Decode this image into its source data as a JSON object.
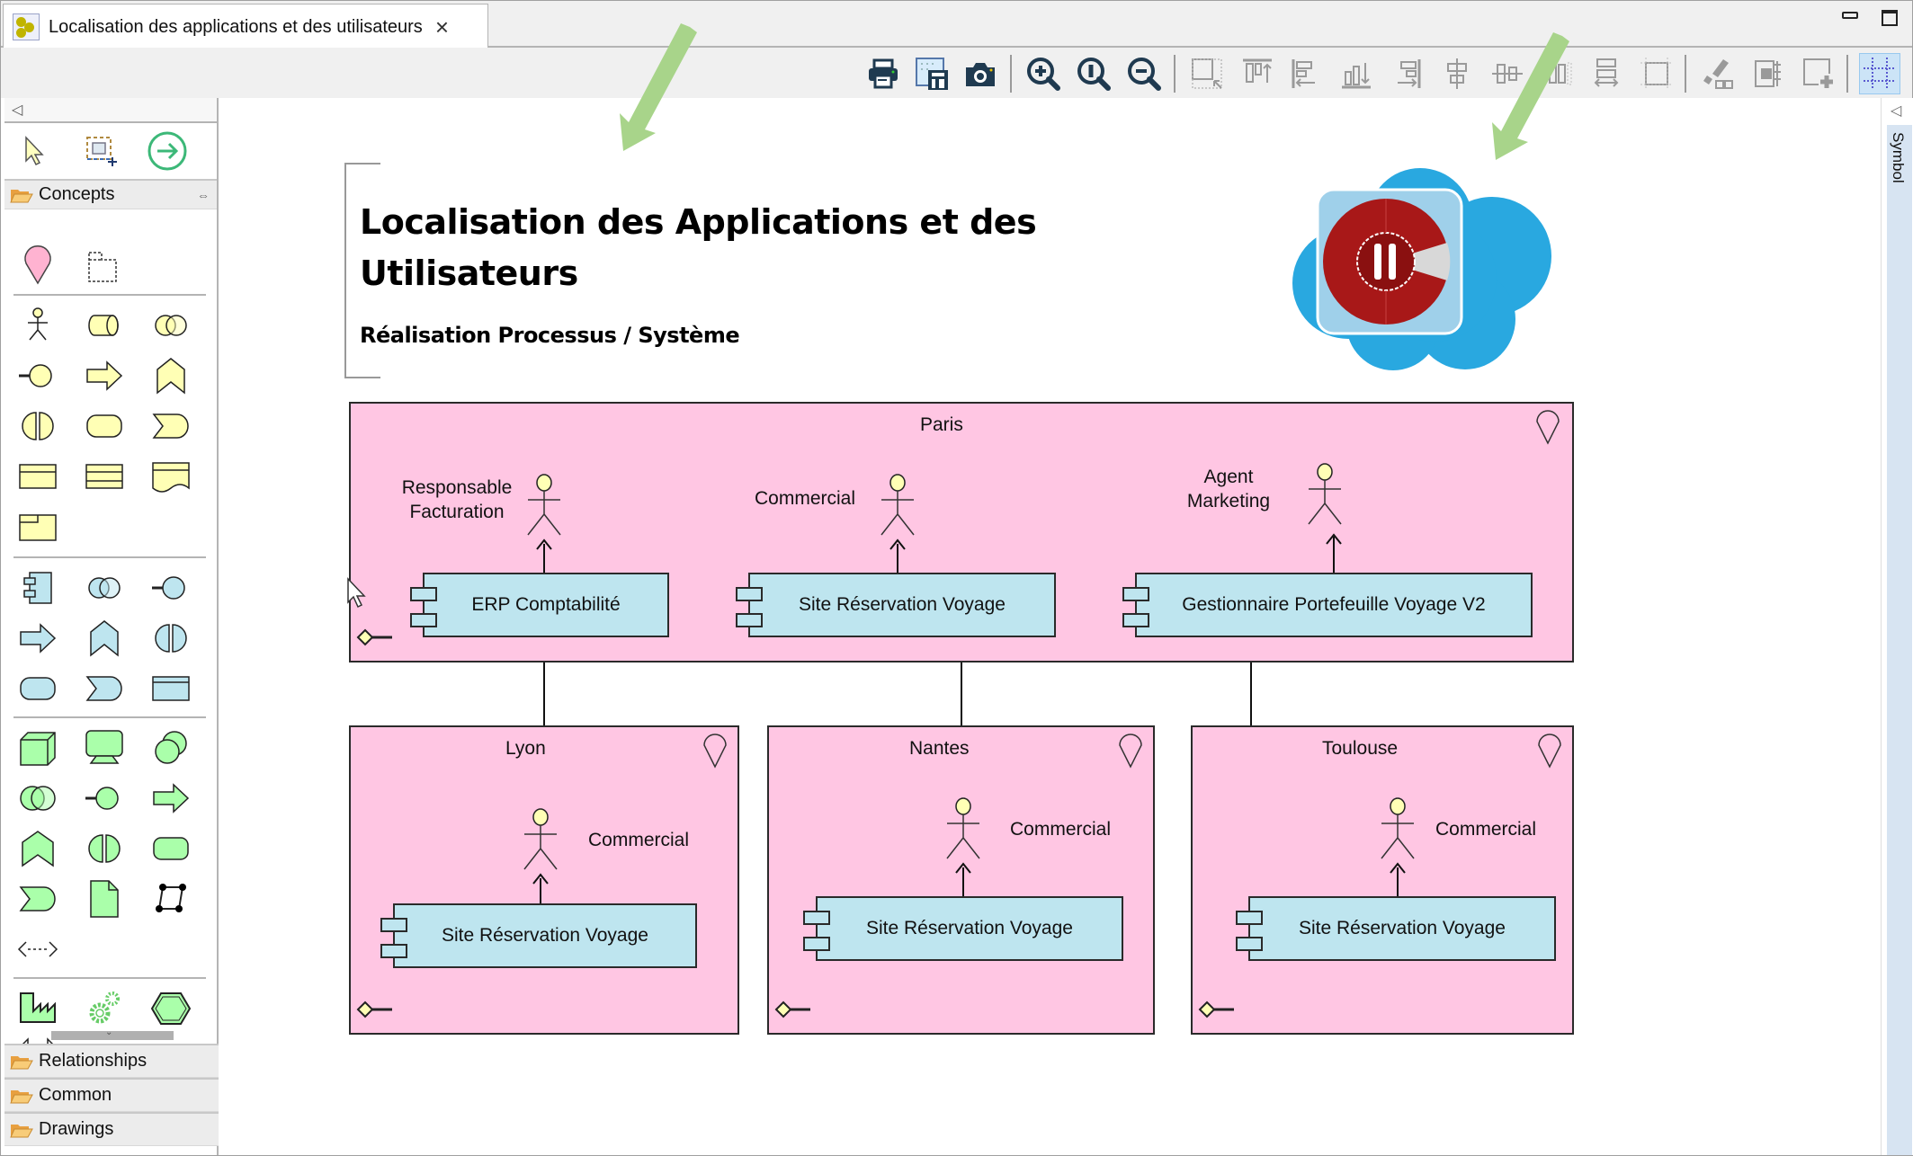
{
  "tab": {
    "title": "Localisation des applications et des utilisateurs",
    "close_label": "×"
  },
  "toolbar": {
    "buttons": [
      {
        "name": "print",
        "icon": "printer-icon"
      },
      {
        "name": "save-as-image",
        "icon": "save-image-icon"
      },
      {
        "name": "snapshot",
        "icon": "camera-icon"
      },
      {
        "name": "zoom-in",
        "icon": "zoom-in-icon"
      },
      {
        "name": "zoom-normal",
        "icon": "zoom-reset-icon"
      },
      {
        "name": "zoom-out",
        "icon": "zoom-out-icon"
      },
      {
        "name": "match-size",
        "icon": "match-size-icon"
      },
      {
        "name": "align-top",
        "icon": "align-top-icon"
      },
      {
        "name": "align-left",
        "icon": "align-left-icon"
      },
      {
        "name": "align-bottom",
        "icon": "align-bottom-icon"
      },
      {
        "name": "align-right",
        "icon": "align-right-icon"
      },
      {
        "name": "align-center",
        "icon": "align-center-icon"
      },
      {
        "name": "align-middle",
        "icon": "align-middle-icon"
      },
      {
        "name": "match-width",
        "icon": "match-width-icon"
      },
      {
        "name": "match-height",
        "icon": "match-height-icon"
      },
      {
        "name": "default-size",
        "icon": "default-size-icon"
      },
      {
        "name": "format-painter",
        "icon": "format-painter-icon"
      },
      {
        "name": "reset-size",
        "icon": "reset-size-icon"
      },
      {
        "name": "new-element",
        "icon": "add-element-icon"
      },
      {
        "name": "grid",
        "icon": "grid-icon"
      }
    ]
  },
  "palette": {
    "drawers": {
      "concepts": "Concepts",
      "relationships": "Relationships",
      "common": "Common",
      "drawings": "Drawings"
    },
    "tools": [
      "select-tool",
      "marquee-tool",
      "magic-connector"
    ]
  },
  "symbol_panel": {
    "label": "Symbol"
  },
  "diagram": {
    "title": "Localisation des Applications et des Utilisateurs",
    "subtitle": "Réalisation Processus / Système",
    "locations": [
      {
        "name": "Paris",
        "actors": [
          {
            "label": "Responsable Facturation",
            "application": "ERP Comptabilité"
          },
          {
            "label": "Commercial",
            "application": "Site Réservation Voyage"
          },
          {
            "label": "Agent Marketing",
            "application": "Gestionnaire Portefeuille Voyage V2"
          }
        ]
      },
      {
        "name": "Lyon",
        "actors": [
          {
            "label": "Commercial",
            "application": "Site Réservation Voyage"
          }
        ]
      },
      {
        "name": "Nantes",
        "actors": [
          {
            "label": "Commercial",
            "application": "Site Réservation Voyage"
          }
        ]
      },
      {
        "name": "Toulouse",
        "actors": [
          {
            "label": "Commercial",
            "application": "Site Réservation Voyage"
          }
        ]
      }
    ]
  },
  "colors": {
    "location_fill": "#ffc6e3",
    "application_fill": "#bee5ef",
    "business_fill": "#ffffb5",
    "technology_fill": "#c9e7b7",
    "annotation_arrow": "#a8d48a",
    "cloud_blue": "#29a8e0"
  }
}
